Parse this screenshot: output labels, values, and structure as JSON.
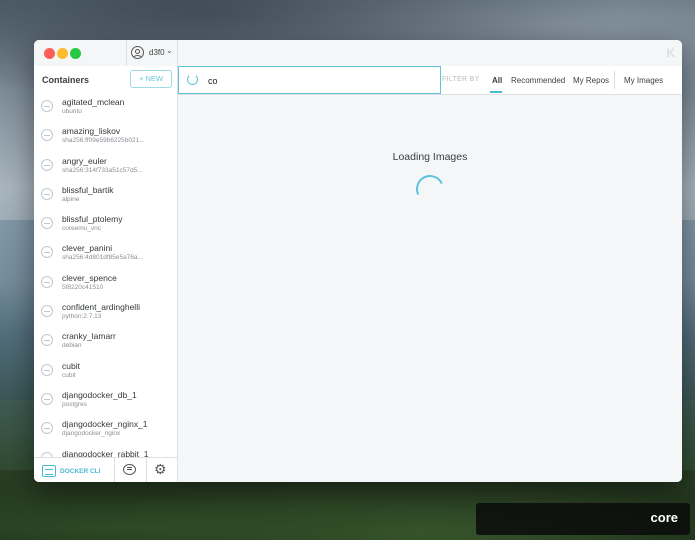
{
  "window": {
    "username": "d3f0",
    "logo": "K"
  },
  "sidebar": {
    "title": "Containers",
    "new_button": "+ NEW",
    "containers": [
      {
        "name": "agitated_mclean",
        "image": "ubuntu"
      },
      {
        "name": "amazing_liskov",
        "image": "sha256:ff09e59b6225b021..."
      },
      {
        "name": "angry_euler",
        "image": "sha256:314f733a51c57d5..."
      },
      {
        "name": "blissful_bartik",
        "image": "alpine"
      },
      {
        "name": "blissful_ptolemy",
        "image": "coreemu_vnc"
      },
      {
        "name": "clever_panini",
        "image": "sha256:4d801df85e5a76a..."
      },
      {
        "name": "clever_spence",
        "image": "5f8220c41510"
      },
      {
        "name": "confident_ardinghelli",
        "image": "python:2.7.13"
      },
      {
        "name": "cranky_lamarr",
        "image": "debian"
      },
      {
        "name": "cubit",
        "image": "cubit"
      },
      {
        "name": "djangodocker_db_1",
        "image": "postgres"
      },
      {
        "name": "djangodocker_nginx_1",
        "image": "djangodocker_nginx"
      },
      {
        "name": "djangodocker_rabbit_1",
        "image": ""
      }
    ],
    "footer": {
      "cli_label": "DOCKER CLI"
    }
  },
  "search": {
    "value": "co"
  },
  "filters": {
    "label": "FILTER BY",
    "items": [
      "All",
      "Recommended",
      "My Repos",
      "My Images"
    ],
    "active": "All"
  },
  "main": {
    "loading_text": "Loading Images"
  },
  "overlay": {
    "caption": "core"
  }
}
